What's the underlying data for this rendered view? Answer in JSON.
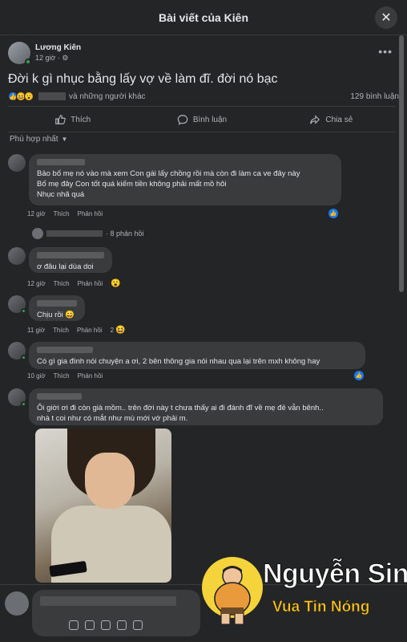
{
  "header": {
    "title": "Bài viết của Kiên",
    "close_icon": "close-icon"
  },
  "post": {
    "author": "Lương Kiên",
    "time": "12 giờ",
    "privacy_icon": "friends-icon",
    "text": "Đời k gì nhục bằng lấy vợ về làm đĩ. đời nó bạc",
    "reactions_text": "và những người khác",
    "reaction_icons": [
      "like-icon",
      "haha-icon",
      "wow-icon"
    ],
    "comment_count": "129 bình luận"
  },
  "actions": {
    "like": "Thích",
    "comment": "Bình luận",
    "share": "Chia sẻ"
  },
  "sort": {
    "label": "Phù hợp nhất"
  },
  "comments": [
    {
      "text": "Bảo bố mẹ nó vào mà xem Con gái lấy chồng rồi mà còn đi làm ca ve đây này\nBố mẹ đây Con tốt quá kiếm tiền không phải mất mồ hôi\nNhục nhã quá",
      "time": "12 giờ",
      "like": "Thích",
      "reply": "Phản hồi",
      "replies": "· 8 phản hồi"
    },
    {
      "text": "ơ đâu lại dùa doi",
      "time": "12 giờ",
      "like": "Thích",
      "reply": "Phản hồi"
    },
    {
      "text": "Chịu rồi 😄",
      "time": "11 giờ",
      "like": "Thích",
      "reply": "Phản hồi",
      "reaction_count": "2"
    },
    {
      "text": "Có gì gia đình nói chuyện a ơi, 2 bên thông gia nói nhau qua lại trên mxh không hay",
      "time": "10 giờ",
      "like": "Thích",
      "reply": "Phản hồi"
    },
    {
      "text": "Ôi giời ơi đi còn già mồm.. trên đời này t chưa thấy ai đi đánh đĩ về mẹ đẻ vẫn bênh..\nnhà t coi như có mắt như mù mới vớ phải m."
    }
  ],
  "watermark": {
    "title": "Nguyễn Sin",
    "subtitle": "Vua Tin Nóng"
  },
  "colors": {
    "background": "#242526",
    "bubble": "#3a3b3c",
    "accent": "#1877f2",
    "online": "#31a24c"
  }
}
